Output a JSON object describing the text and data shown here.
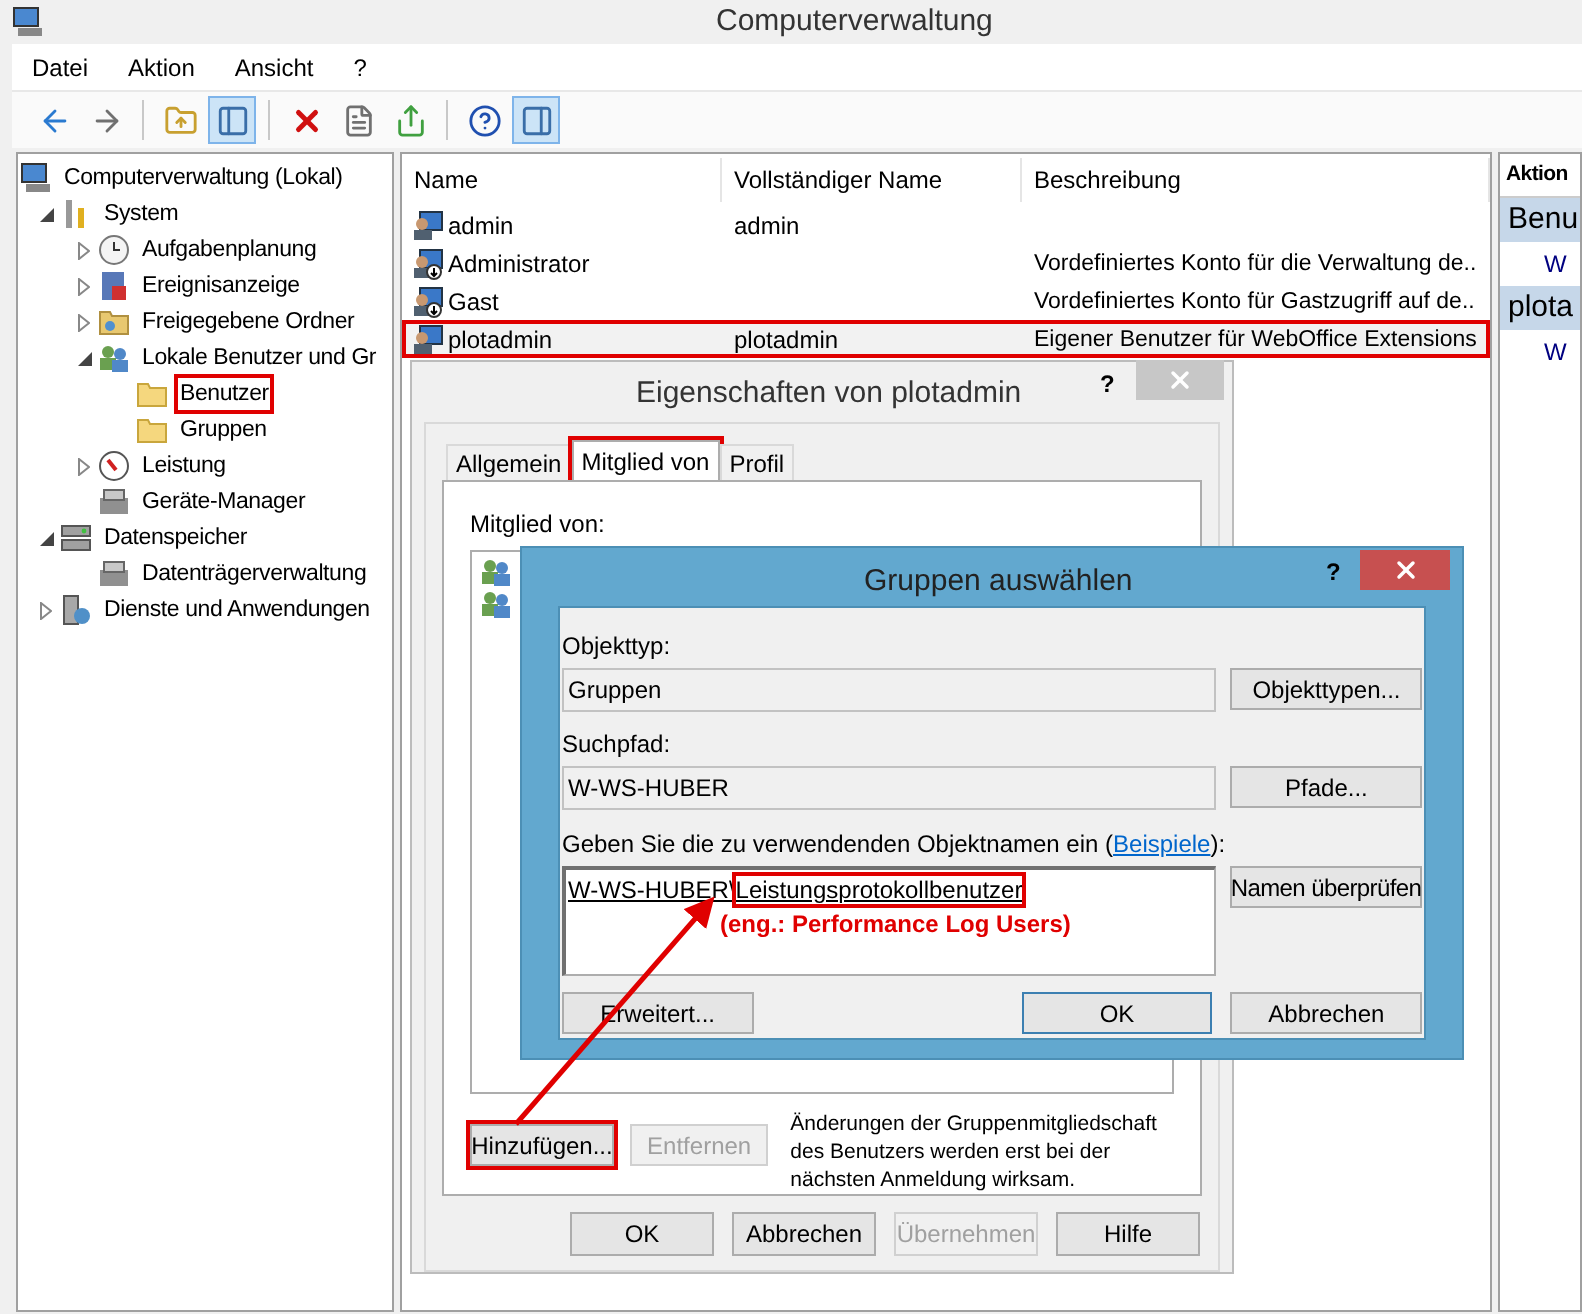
{
  "window": {
    "title": "Computerverwaltung"
  },
  "menu": [
    "Datei",
    "Aktion",
    "Ansicht",
    "?"
  ],
  "toolbar": [
    {
      "kind": "back",
      "pressed": false
    },
    {
      "kind": "forward",
      "pressed": false
    },
    {
      "kind": "separator"
    },
    {
      "kind": "up",
      "pressed": false
    },
    {
      "kind": "tree",
      "pressed": true
    },
    {
      "kind": "separator"
    },
    {
      "kind": "delete",
      "pressed": false
    },
    {
      "kind": "properties",
      "pressed": false
    },
    {
      "kind": "export",
      "pressed": false
    },
    {
      "kind": "separator"
    },
    {
      "kind": "help",
      "pressed": false
    },
    {
      "kind": "pane",
      "pressed": true
    }
  ],
  "tree": [
    {
      "label": "Computerverwaltung (Lokal)",
      "kind": "computer",
      "highlighted": false,
      "children": [
        {
          "label": "System",
          "kind": "tools",
          "expanded": true,
          "highlighted": false,
          "children": [
            {
              "label": "Aufgabenplanung",
              "kind": "clock",
              "expanded": false,
              "highlighted": false
            },
            {
              "label": "Ereignisanzeige",
              "kind": "log",
              "expanded": false,
              "highlighted": false
            },
            {
              "label": "Freigegebene Ordner",
              "kind": "share",
              "expanded": false,
              "highlighted": false
            },
            {
              "label": "Lokale Benutzer und Gr",
              "kind": "users",
              "expanded": true,
              "highlighted": false,
              "children": [
                {
                  "label": "Benutzer",
                  "kind": "folder",
                  "highlighted": true
                },
                {
                  "label": "Gruppen",
                  "kind": "folder",
                  "highlighted": false
                }
              ]
            },
            {
              "label": "Leistung",
              "kind": "gauge",
              "expanded": false,
              "highlighted": false
            },
            {
              "label": "Geräte-Manager",
              "kind": "device",
              "highlighted": false
            }
          ]
        },
        {
          "label": "Datenspeicher",
          "kind": "storage",
          "expanded": true,
          "highlighted": false,
          "children": [
            {
              "label": "Datenträgerverwaltung",
              "kind": "device",
              "highlighted": false
            }
          ]
        },
        {
          "label": "Dienste und Anwendungen",
          "kind": "services",
          "expanded": false,
          "highlighted": false
        }
      ]
    }
  ],
  "table": {
    "columns": [
      "Name",
      "Vollständiger Name",
      "Beschreibung"
    ],
    "rows": [
      {
        "cells": [
          "admin",
          "admin",
          ""
        ],
        "disabled_account": false,
        "highlighted": false
      },
      {
        "cells": [
          "Administrator",
          "",
          "Vordefiniertes Konto für die Verwaltung de.."
        ],
        "disabled_account": true,
        "highlighted": false
      },
      {
        "cells": [
          "Gast",
          "",
          "Vordefiniertes Konto für Gastzugriff auf de.."
        ],
        "disabled_account": true,
        "highlighted": false
      },
      {
        "cells": [
          "plotadmin",
          "plotadmin",
          "Eigener Benutzer für WebOffice Extensions"
        ],
        "disabled_account": false,
        "highlighted": true
      }
    ]
  },
  "actions": {
    "header": "Aktion",
    "sections": [
      {
        "title": "Benu",
        "items": [
          "W"
        ]
      },
      {
        "title": "plota",
        "items": [
          "W"
        ]
      }
    ]
  },
  "properties_dialog": {
    "title": "Eigenschaften von plotadmin",
    "help": "?",
    "tabs": [
      {
        "label": "Allgemein",
        "selected": false,
        "highlighted": false
      },
      {
        "label": "Mitglied von",
        "selected": true,
        "highlighted": true
      },
      {
        "label": "Profil",
        "selected": false,
        "highlighted": false
      }
    ],
    "members_label": "Mitglied von:",
    "members": [
      {
        "kind": "group"
      },
      {
        "kind": "group"
      }
    ],
    "add_button": {
      "label": "Hinzufügen...",
      "disabled": false,
      "highlighted": true
    },
    "remove_button": {
      "label": "Entfernen",
      "disabled": true,
      "highlighted": false
    },
    "note": "Änderungen der Gruppenmitgliedschaft des Benutzers werden erst bei der nächsten Anmeldung wirksam.",
    "buttons": [
      {
        "label": "OK",
        "disabled": false
      },
      {
        "label": "Abbrechen",
        "disabled": false
      },
      {
        "label": "Übernehmen",
        "disabled": true
      },
      {
        "label": "Hilfe",
        "disabled": false
      }
    ]
  },
  "groups_dialog": {
    "title": "Gruppen auswählen",
    "help": "?",
    "object_type_label": "Objekttyp:",
    "object_type": "Gruppen",
    "object_types_button": "Objekttypen...",
    "path_label": "Suchpfad:",
    "path": "W-WS-HUBER",
    "path_button": "Pfade...",
    "names_label": "Geben Sie die zu verwendenden Objektnamen ein (",
    "names_link": "Beispiele",
    "names_label_end": "):",
    "names_value": "W-WS-HUBER\\",
    "names_value_highlighted": "Leistungsprotokollbenutzer",
    "check_button": "Namen überprüfen",
    "annotation": "(eng.: Performance Log Users)",
    "advanced_button": "Erweitert...",
    "ok_button": "OK",
    "cancel_button": "Abbrechen"
  }
}
